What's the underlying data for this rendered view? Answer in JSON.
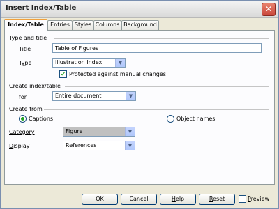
{
  "window": {
    "title": "Insert Index/Table"
  },
  "tabs": [
    {
      "label": "Index/Table"
    },
    {
      "label": "Entries"
    },
    {
      "label": "Styles"
    },
    {
      "label": "Columns"
    },
    {
      "label": "Background"
    }
  ],
  "type_title": {
    "section": "Type and title",
    "title_label": "Title",
    "title_value": "Table of Figures",
    "type_label": "Type",
    "type_value": "Illustration Index",
    "protected_label": "Protected against manual changes",
    "protected_checked": true
  },
  "create_index": {
    "section": "Create index/table",
    "for_label": "for",
    "for_value": "Entire document"
  },
  "create_from": {
    "section": "Create from",
    "captions_label": "Captions",
    "object_names_label": "Object names",
    "selected": "captions",
    "category_label": "Category",
    "category_value": "Figure",
    "display_label": "Display",
    "display_value": "References"
  },
  "buttons": {
    "ok": "OK",
    "cancel": "Cancel",
    "help": "Help",
    "reset": "Reset",
    "preview": "Preview"
  },
  "icons": {
    "close": "close-icon",
    "dropdown": "chevron-down-icon"
  },
  "colors": {
    "accent_tab": "#f1a13c",
    "checkmark": "#21a121",
    "close": "#c8453a"
  }
}
